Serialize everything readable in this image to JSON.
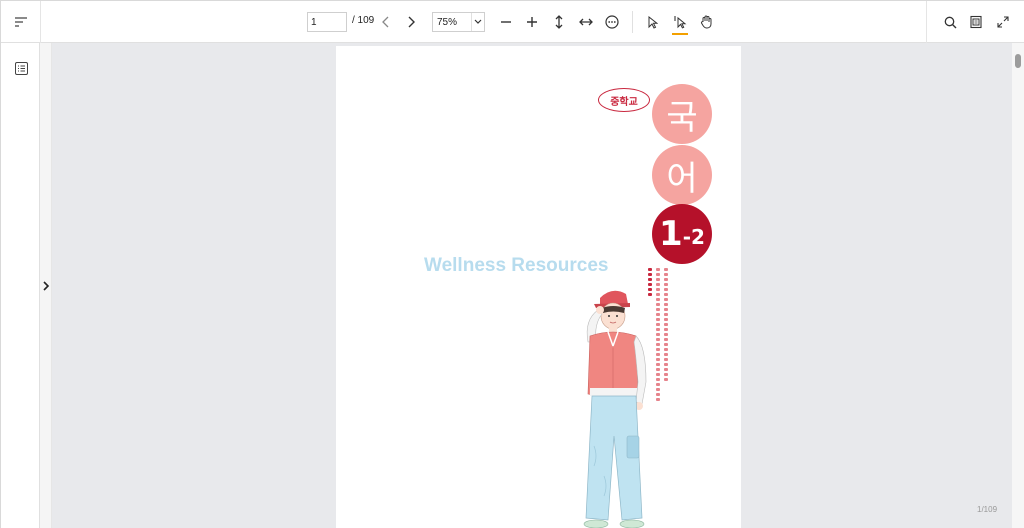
{
  "toolbar": {
    "page_current": "1",
    "page_total": "/ 109",
    "zoom_value": "75%",
    "icons": [
      "sort-icon",
      "chevron-left-icon",
      "chevron-right-icon",
      "zoom-out-icon",
      "zoom-in-icon",
      "fit-height-icon",
      "fit-width-icon",
      "more-options-icon",
      "select-cursor-icon",
      "text-cursor-icon",
      "hand-pan-icon",
      "search-icon",
      "print-icon",
      "fullscreen-icon"
    ]
  },
  "sidebar": {
    "icons": [
      "outline-list-icon",
      "expand-chevron-icon"
    ]
  },
  "document": {
    "school_label": "중학교",
    "subject_char_1": "국",
    "subject_char_2": "어",
    "grade_main": "1",
    "grade_sub": "-2",
    "watermark": "Wellness Resources",
    "page_footer": "1/109"
  },
  "colors": {
    "accent_underline": "#f3a000",
    "badge_red": "#c9283f",
    "circle_pink": "#f5a4a0",
    "circle_dark_red": "#b5112a",
    "watermark_blue": "#b7dcee",
    "viewer_bg": "#e8e9ec"
  }
}
